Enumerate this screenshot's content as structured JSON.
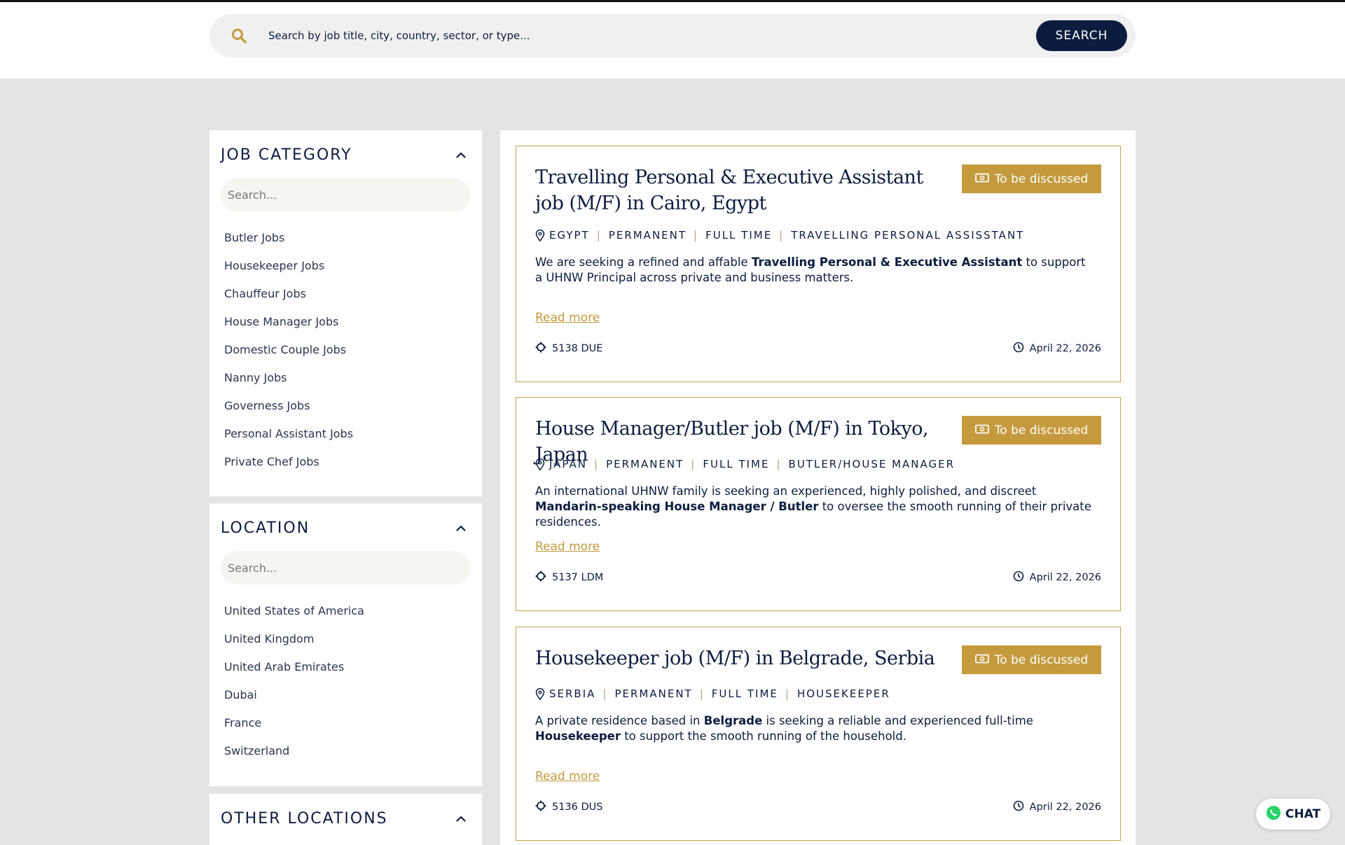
{
  "search": {
    "placeholder": "Search by job title, city, country, sector, or type...",
    "button_label": "SEARCH"
  },
  "filters": {
    "job_category": {
      "title": "JOB CATEGORY",
      "search_placeholder": "Search...",
      "items": [
        "Butler Jobs",
        "Housekeeper Jobs",
        "Chauffeur Jobs",
        "House Manager Jobs",
        "Domestic Couple Jobs",
        "Nanny Jobs",
        "Governess Jobs",
        "Personal Assistant Jobs",
        "Private Chef Jobs"
      ]
    },
    "location": {
      "title": "LOCATION",
      "search_placeholder": "Search...",
      "items": [
        "United States of America",
        "United Kingdom",
        "United Arab Emirates",
        "Dubai",
        "France",
        "Switzerland"
      ]
    },
    "other_locations": {
      "title": "OTHER LOCATIONS"
    }
  },
  "jobs": [
    {
      "title": "Travelling Personal & Executive Assistant job (M/F) in Cairo, Egypt",
      "salary": "To be discussed",
      "location": "EGYPT",
      "contract": "PERMANENT",
      "schedule": "FULL TIME",
      "role": "TRAVELLING PERSONAL ASSISSTANT",
      "desc_parts": [
        "We are seeking a refined and affable ",
        "Travelling Personal & Executive Assistant",
        " to support a UHNW Principal across private and business matters."
      ],
      "read_more": "Read more",
      "reference": "5138 DUE",
      "date": "April 22, 2026"
    },
    {
      "title": "House Manager/Butler job (M/F) in Tokyo, Japan",
      "salary": "To be discussed",
      "location": "JAPAN",
      "contract": "PERMANENT",
      "schedule": "FULL TIME",
      "role": "BUTLER/HOUSE MANAGER",
      "desc_parts": [
        "An international UHNW family is seeking an experienced, highly polished, and discreet ",
        "Mandarin-speaking House Manager / Butler",
        " to oversee the smooth running of their private residences."
      ],
      "read_more": "Read more",
      "reference": "5137 LDM",
      "date": "April 22, 2026"
    },
    {
      "title": "Housekeeper job (M/F) in Belgrade, Serbia",
      "salary": "To be discussed",
      "location": "SERBIA",
      "contract": "PERMANENT",
      "schedule": "FULL TIME",
      "role": "HOUSEKEEPER",
      "desc_parts": [
        "A private residence based in ",
        "Belgrade",
        " is seeking a reliable and experienced full-time ",
        "Housekeeper",
        " to support the smooth running of the household."
      ],
      "read_more": "Read more",
      "reference": "5136 DUS",
      "date": "April 22, 2026"
    }
  ],
  "chat": {
    "label": "CHAT"
  },
  "colors": {
    "navy": "#0b1d3f",
    "gold": "#c49a3d",
    "background": "#e4e4e4",
    "whatsapp": "#25d366"
  }
}
